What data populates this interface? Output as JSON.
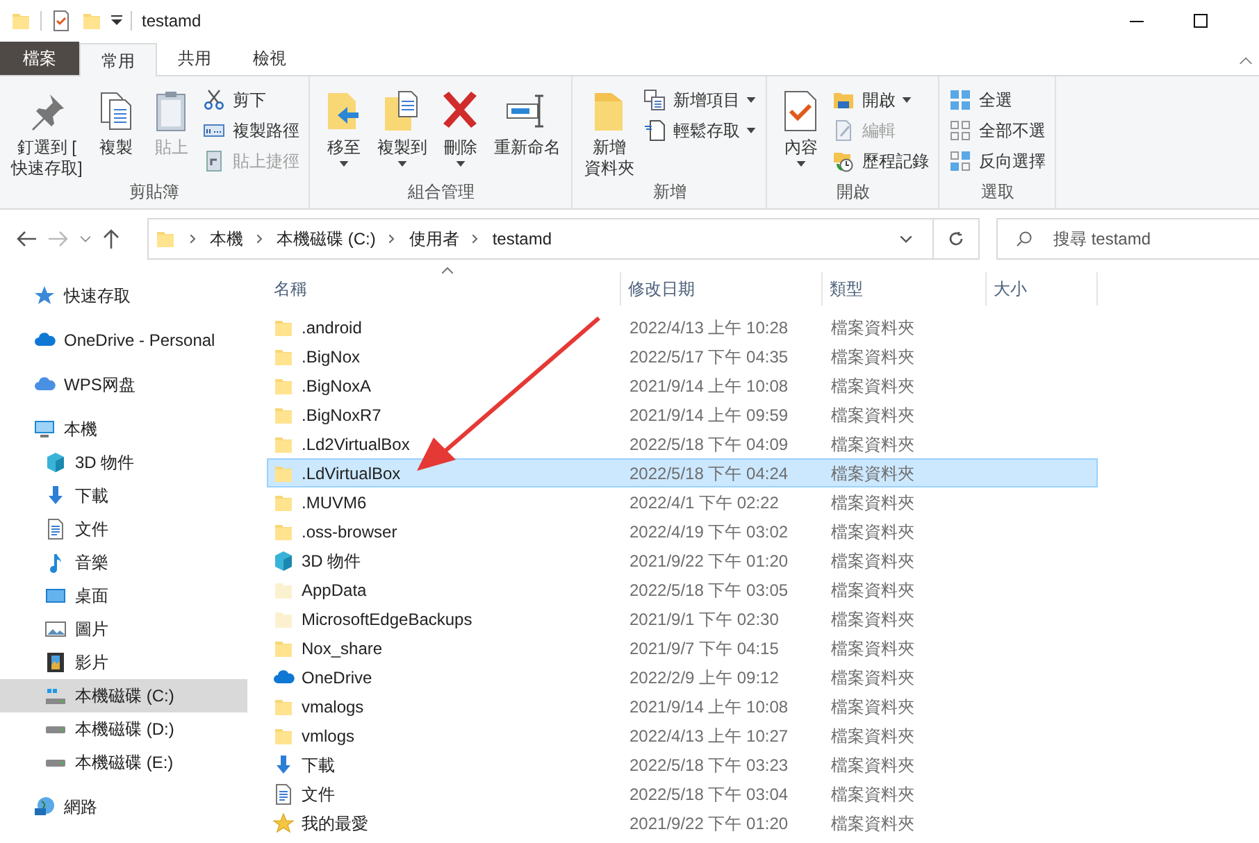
{
  "window": {
    "title": "testamd"
  },
  "ribbon_tabs": [
    {
      "label": "檔案",
      "kind": "file",
      "selected": false
    },
    {
      "label": "常用",
      "kind": "tab",
      "selected": true
    },
    {
      "label": "共用",
      "kind": "tab",
      "selected": false
    },
    {
      "label": "檢視",
      "kind": "tab",
      "selected": false
    }
  ],
  "ribbon_groups": [
    {
      "label": "剪貼簿",
      "large": [
        {
          "lines": [
            "釘選到 [",
            "快速存取]"
          ],
          "kind": "pin",
          "disabled": false,
          "dropdown": false
        },
        {
          "lines": [
            "複製"
          ],
          "kind": "copy",
          "disabled": false,
          "dropdown": false
        },
        {
          "lines": [
            "貼上"
          ],
          "kind": "paste",
          "disabled": true,
          "dropdown": false
        }
      ],
      "small": [
        {
          "label": "剪下",
          "kind": "cut",
          "disabled": false,
          "dropdown": false
        },
        {
          "label": "複製路徑",
          "kind": "copypath",
          "disabled": false,
          "dropdown": false
        },
        {
          "label": "貼上捷徑",
          "kind": "shortcut",
          "disabled": true,
          "dropdown": false
        }
      ]
    },
    {
      "label": "組合管理",
      "large": [
        {
          "lines": [
            "移至"
          ],
          "kind": "moveto",
          "disabled": false,
          "dropdown": true
        },
        {
          "lines": [
            "複製到"
          ],
          "kind": "copyto",
          "disabled": false,
          "dropdown": true
        },
        {
          "lines": [
            "刪除"
          ],
          "kind": "delete",
          "disabled": false,
          "dropdown": true
        },
        {
          "lines": [
            "重新命名"
          ],
          "kind": "rename",
          "disabled": false,
          "dropdown": false
        }
      ]
    },
    {
      "label": "新增",
      "large": [
        {
          "lines": [
            "新增",
            "資料夾"
          ],
          "kind": "newfolder",
          "disabled": false,
          "dropdown": false
        }
      ],
      "small": [
        {
          "label": "新增項目",
          "kind": "newitem",
          "disabled": false,
          "dropdown": true
        },
        {
          "label": "輕鬆存取",
          "kind": "easyaccess",
          "disabled": false,
          "dropdown": true
        }
      ]
    },
    {
      "label": "開啟",
      "large": [
        {
          "lines": [
            "內容"
          ],
          "kind": "properties",
          "disabled": false,
          "dropdown": true
        }
      ],
      "small": [
        {
          "label": "開啟",
          "kind": "open",
          "disabled": false,
          "dropdown": true
        },
        {
          "label": "編輯",
          "kind": "edit",
          "disabled": true,
          "dropdown": false
        },
        {
          "label": "歷程記錄",
          "kind": "history",
          "disabled": false,
          "dropdown": false
        }
      ]
    },
    {
      "label": "選取",
      "small": [
        {
          "label": "全選",
          "kind": "selectall",
          "disabled": false,
          "dropdown": false
        },
        {
          "label": "全部不選",
          "kind": "selectnone",
          "disabled": false,
          "dropdown": false
        },
        {
          "label": "反向選擇",
          "kind": "invert",
          "disabled": false,
          "dropdown": false
        }
      ]
    }
  ],
  "address_bar": {
    "path": [
      "本機",
      "本機磁碟 (C:)",
      "使用者",
      "testamd"
    ],
    "search": {
      "placeholder": "搜尋 testamd"
    }
  },
  "navigation": [
    {
      "label": "快速存取",
      "kind": "star",
      "selected": false
    },
    {
      "label": "OneDrive - Personal",
      "kind": "cloud",
      "selected": false
    },
    {
      "label": "WPS网盘",
      "kind": "wps",
      "selected": false
    },
    {
      "label": "本機",
      "kind": "pc",
      "selected": false,
      "children": [
        {
          "label": "3D 物件",
          "kind": "cube",
          "selected": false
        },
        {
          "label": "下載",
          "kind": "download",
          "selected": false
        },
        {
          "label": "文件",
          "kind": "document",
          "selected": false
        },
        {
          "label": "音樂",
          "kind": "music",
          "selected": false
        },
        {
          "label": "桌面",
          "kind": "desktop",
          "selected": false
        },
        {
          "label": "圖片",
          "kind": "picture",
          "selected": false
        },
        {
          "label": "影片",
          "kind": "film",
          "selected": false
        },
        {
          "label": "本機磁碟 (C:)",
          "kind": "drive-c",
          "selected": true
        },
        {
          "label": "本機磁碟 (D:)",
          "kind": "drive",
          "selected": false
        },
        {
          "label": "本機磁碟 (E:)",
          "kind": "drive",
          "selected": false
        }
      ]
    },
    {
      "label": "網路",
      "kind": "network",
      "selected": false
    }
  ],
  "table": {
    "columns": [
      "名稱",
      "修改日期",
      "類型",
      "大小"
    ],
    "rows": [
      {
        "name": ".android",
        "date": "2022/4/13 上午 10:28",
        "type": "檔案資料夾",
        "kind": "folder",
        "selected": false
      },
      {
        "name": ".BigNox",
        "date": "2022/5/17 下午 04:35",
        "type": "檔案資料夾",
        "kind": "folder",
        "selected": false
      },
      {
        "name": ".BigNoxA",
        "date": "2021/9/14 上午 10:08",
        "type": "檔案資料夾",
        "kind": "folder",
        "selected": false
      },
      {
        "name": ".BigNoxR7",
        "date": "2021/9/14 上午 09:59",
        "type": "檔案資料夾",
        "kind": "folder",
        "selected": false
      },
      {
        "name": ".Ld2VirtualBox",
        "date": "2022/5/18 下午 04:09",
        "type": "檔案資料夾",
        "kind": "folder",
        "selected": false
      },
      {
        "name": ".LdVirtualBox",
        "date": "2022/5/18 下午 04:24",
        "type": "檔案資料夾",
        "kind": "folder",
        "selected": true
      },
      {
        "name": ".MUVM6",
        "date": "2022/4/1 下午 02:22",
        "type": "檔案資料夾",
        "kind": "folder",
        "selected": false
      },
      {
        "name": ".oss-browser",
        "date": "2022/4/19 下午 03:02",
        "type": "檔案資料夾",
        "kind": "folder",
        "selected": false
      },
      {
        "name": "3D 物件",
        "date": "2021/9/22 下午 01:20",
        "type": "檔案資料夾",
        "kind": "cube",
        "selected": false
      },
      {
        "name": "AppData",
        "date": "2022/5/18 下午 03:05",
        "type": "檔案資料夾",
        "kind": "hidden",
        "selected": false
      },
      {
        "name": "MicrosoftEdgeBackups",
        "date": "2021/9/1 下午 02:30",
        "type": "檔案資料夾",
        "kind": "hidden",
        "selected": false
      },
      {
        "name": "Nox_share",
        "date": "2021/9/7 下午 04:15",
        "type": "檔案資料夾",
        "kind": "folder",
        "selected": false
      },
      {
        "name": "OneDrive",
        "date": "2022/2/9 上午 09:12",
        "type": "檔案資料夾",
        "kind": "cloud",
        "selected": false
      },
      {
        "name": "vmalogs",
        "date": "2021/9/14 上午 10:08",
        "type": "檔案資料夾",
        "kind": "folder",
        "selected": false
      },
      {
        "name": "vmlogs",
        "date": "2022/4/13 上午 10:27",
        "type": "檔案資料夾",
        "kind": "folder",
        "selected": false
      },
      {
        "name": "下載",
        "date": "2022/5/18 下午 03:23",
        "type": "檔案資料夾",
        "kind": "download",
        "selected": false
      },
      {
        "name": "文件",
        "date": "2022/5/18 下午 03:04",
        "type": "檔案資料夾",
        "kind": "document",
        "selected": false
      },
      {
        "name": "我的最愛",
        "date": "2021/9/22 下午 01:20",
        "type": "檔案資料夾",
        "kind": "star",
        "selected": false
      }
    ]
  }
}
